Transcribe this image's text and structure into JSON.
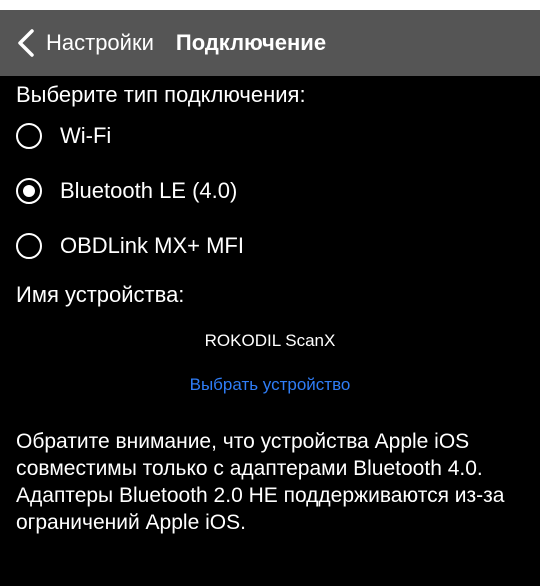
{
  "navbar": {
    "back_label": "Настройки",
    "title": "Подключение",
    "back_icon": "chevron-left-icon"
  },
  "connection": {
    "prompt": "Выберите тип подключения:",
    "options": [
      {
        "label": "Wi-Fi",
        "selected": false
      },
      {
        "label": "Bluetooth LE (4.0)",
        "selected": true
      },
      {
        "label": "OBDLink MX+ MFI",
        "selected": false
      }
    ]
  },
  "device": {
    "label": "Имя устройства:",
    "name": "ROKODIL ScanX",
    "select_label": "Выбрать устройство"
  },
  "notice": {
    "line1": "Обратите внимание, что устройства Apple iOS совместимы только с адаптерами Bluetooth 4.0.",
    "line2": "Адаптеры Bluetooth 2.0 НЕ поддерживаются из-за ограничений Apple iOS."
  },
  "colors": {
    "background": "#000000",
    "navbar": "#555555",
    "link": "#2f7df6",
    "text": "#ffffff"
  }
}
